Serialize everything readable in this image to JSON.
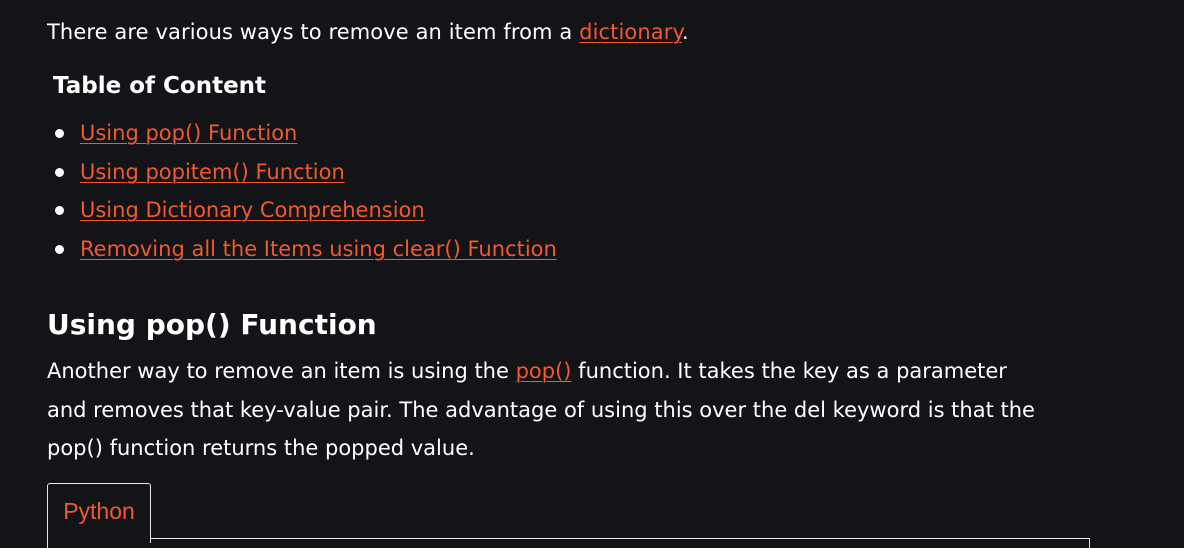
{
  "intro": {
    "prefix": "There are various ways to remove an item from a ",
    "link": "dictionary",
    "suffix": "."
  },
  "toc": {
    "title": "Table of Content",
    "items": [
      {
        "label": "Using pop() Function"
      },
      {
        "label": "Using popitem() Function"
      },
      {
        "label": "Using Dictionary Comprehension"
      },
      {
        "label": "Removing all the Items using clear() Function"
      }
    ]
  },
  "section": {
    "title": "Using pop() Function",
    "line1_prefix": "Another way to remove an item is using the ",
    "line1_link": "pop()",
    "line1_suffix": " function. It takes the key as a parameter",
    "line2": "and removes that key-value pair. The advantage of using this over the del keyword is that the",
    "line3": "pop() function returns the popped value."
  },
  "code": {
    "tab_label": "Python"
  },
  "colors": {
    "background": "#131417",
    "link": "#f3592e",
    "text": "#ffffff"
  }
}
